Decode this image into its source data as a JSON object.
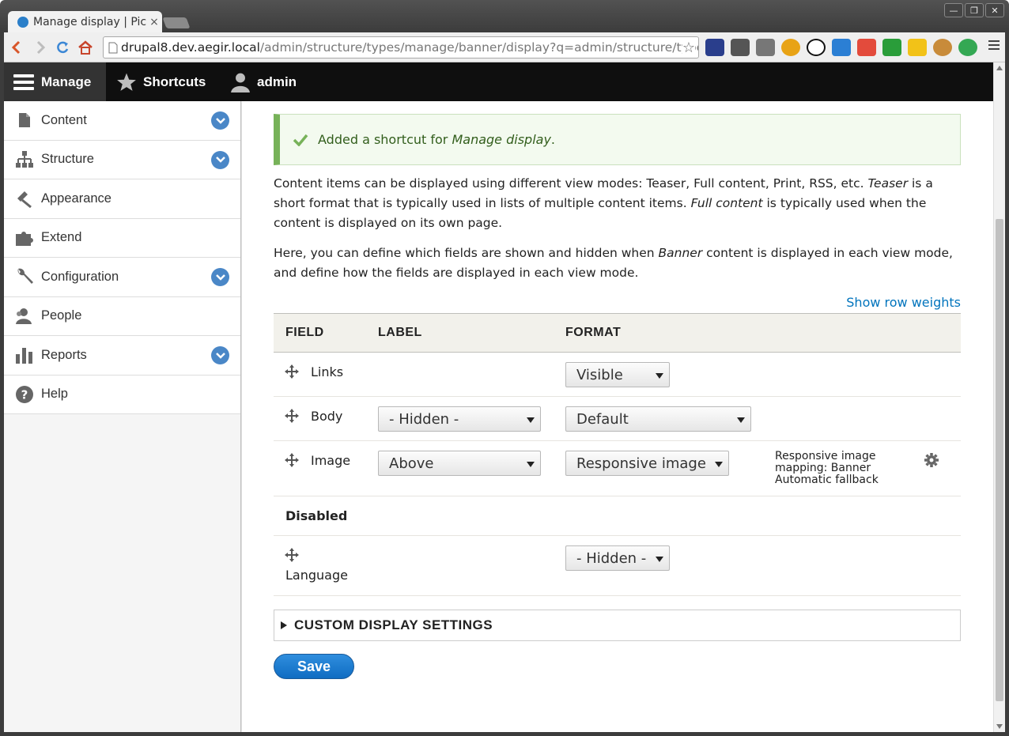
{
  "browser": {
    "tab_title": "Manage display | Pictu",
    "tab_close": "×",
    "url_host": "drupal8.dev.aegir.local",
    "url_path": "/admin/structure/types/manage/banner/display?q=admin/structure/types/ma",
    "bookmark_star": "☆",
    "window_buttons": [
      "—",
      "❐",
      "✕"
    ]
  },
  "drupal_toolbar": {
    "manage": "Manage",
    "shortcuts": "Shortcuts",
    "user": "admin"
  },
  "sidebar": {
    "items": [
      {
        "label": "Content",
        "icon": "file-icon",
        "expandable": true
      },
      {
        "label": "Structure",
        "icon": "sitemap-icon",
        "expandable": true
      },
      {
        "label": "Appearance",
        "icon": "paintbrush-icon",
        "expandable": false
      },
      {
        "label": "Extend",
        "icon": "puzzle-icon",
        "expandable": false
      },
      {
        "label": "Configuration",
        "icon": "wrench-icon",
        "expandable": true
      },
      {
        "label": "People",
        "icon": "people-icon",
        "expandable": false
      },
      {
        "label": "Reports",
        "icon": "bar-chart-icon",
        "expandable": true
      },
      {
        "label": "Help",
        "icon": "help-icon",
        "expandable": false
      }
    ]
  },
  "message": {
    "prefix": "Added a shortcut for ",
    "emphasis": "Manage display",
    "suffix": "."
  },
  "intro": {
    "p1_a": "Content items can be displayed using different view modes: Teaser, Full content, Print, RSS, etc. ",
    "p1_em1": "Teaser",
    "p1_b": " is a short format that is typically used in lists of multiple content items. ",
    "p1_em2": "Full content",
    "p1_c": " is typically used when the content is displayed on its own page.",
    "p2_a": "Here, you can define which fields are shown and hidden when ",
    "p2_em": "Banner",
    "p2_b": " content is displayed in each view mode, and define how the fields are displayed in each view mode."
  },
  "show_row_weights": "Show row weights",
  "table": {
    "headers": {
      "field": "FIELD",
      "label": "LABEL",
      "format": "FORMAT"
    },
    "rows": [
      {
        "field": "Links",
        "label": "",
        "format": "Visible",
        "summary": ""
      },
      {
        "field": "Body",
        "label": "- Hidden -",
        "format": "Default",
        "summary": ""
      },
      {
        "field": "Image",
        "label": "Above",
        "format": "Responsive image",
        "summary": "Responsive image mapping: Banner Automatic fallback"
      }
    ],
    "disabled_heading": "Disabled",
    "disabled_rows": [
      {
        "field": "Language",
        "format": "- Hidden -"
      }
    ]
  },
  "custom_display_settings": "CUSTOM DISPLAY SETTINGS",
  "save_button": "Save",
  "colors": {
    "accent_blue": "#0074bd",
    "status_green": "#77b259",
    "toolbar_black": "#0f0f0f"
  }
}
